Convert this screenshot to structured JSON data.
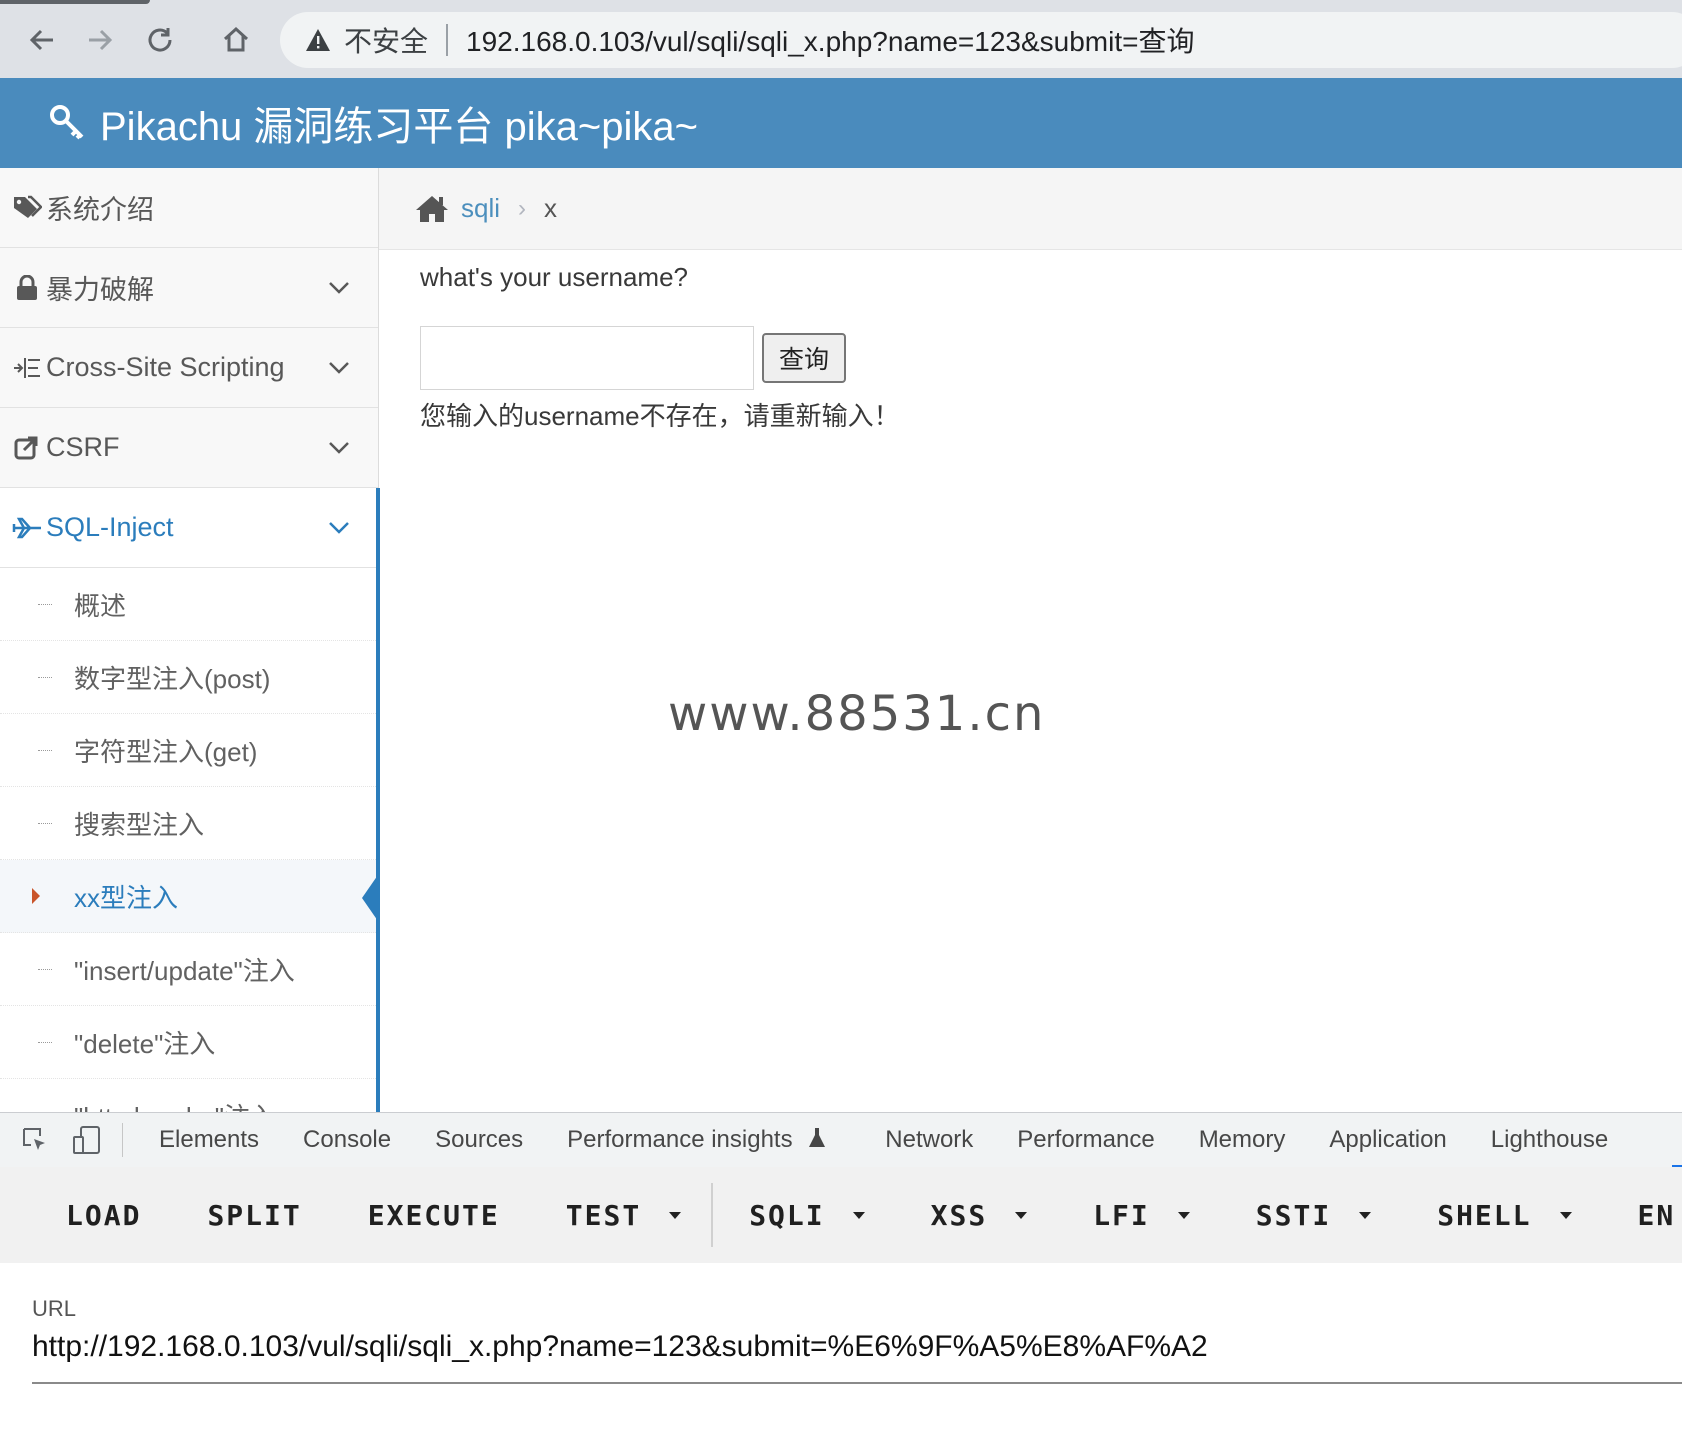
{
  "browser": {
    "security_label": "不安全",
    "address_url": "192.168.0.103/vul/sqli/sqli_x.php?name=123&submit=查询"
  },
  "site": {
    "title": "Pikachu 漏洞练习平台 pika~pika~"
  },
  "sidebar": {
    "items": [
      {
        "label": "系统介绍",
        "icon": "tags-icon"
      },
      {
        "label": "暴力破解",
        "icon": "lock-icon"
      },
      {
        "label": "Cross-Site Scripting",
        "icon": "indent-icon"
      },
      {
        "label": "CSRF",
        "icon": "share-icon"
      },
      {
        "label": "SQL-Inject",
        "icon": "plane-icon"
      }
    ],
    "sub_items": [
      {
        "label": "概述"
      },
      {
        "label": "数字型注入(post)"
      },
      {
        "label": "字符型注入(get)"
      },
      {
        "label": "搜索型注入"
      },
      {
        "label": "xx型注入"
      },
      {
        "label": "\"insert/update\"注入"
      },
      {
        "label": "\"delete\"注入"
      },
      {
        "label": "\"http header\"注入"
      }
    ]
  },
  "breadcrumb": {
    "section": "sqli",
    "current": "x"
  },
  "main": {
    "question": "what's your username?",
    "input_value": "",
    "button_label": "查询",
    "result_message": "您输入的username不存在，请重新输入！",
    "watermark": "www.88531.cn"
  },
  "devtools": {
    "tabs": [
      "Elements",
      "Console",
      "Sources",
      "Performance insights",
      "Network",
      "Performance",
      "Memory",
      "Application",
      "Lighthouse"
    ]
  },
  "hackbar": {
    "buttons": [
      "LOAD",
      "SPLIT",
      "EXECUTE",
      "TEST",
      "SQLI",
      "XSS",
      "LFI",
      "SSTI",
      "SHELL",
      "EN"
    ],
    "url_label": "URL",
    "url_value": "http://192.168.0.103/vul/sqli/sqli_x.php?name=123&submit=%E6%9F%A5%E8%AF%A2"
  },
  "colors": {
    "header_bg": "#4a8bbd",
    "accent": "#2b7dbc",
    "active_caret": "#c9552b"
  }
}
